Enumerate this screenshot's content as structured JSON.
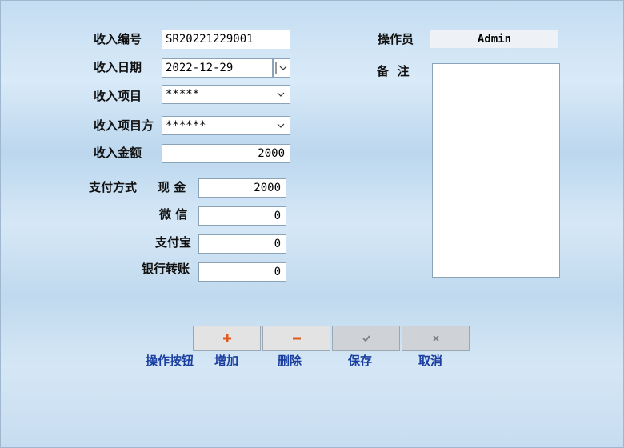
{
  "form": {
    "income_no_label": "收入编号",
    "income_no": "SR20221229001",
    "income_date_label": "收入日期",
    "income_date": "2022-12-29",
    "income_item_label": "收入项目",
    "income_item": "*****",
    "income_party_label": "收入项目方",
    "income_party": "******",
    "income_amount_label": "收入金额",
    "income_amount": "2000",
    "payment_method_label": "支付方式",
    "cash_label": "现 金",
    "cash": "2000",
    "wechat_label": "微 信",
    "wechat": "0",
    "alipay_label": "支付宝",
    "alipay": "0",
    "bank_label": "银行转账",
    "bank": "0",
    "operator_label": "操作员",
    "operator": "Admin",
    "remarks_label": "备  注",
    "remarks": ""
  },
  "toolbar": {
    "title": "操作按钮",
    "add_label": "增加",
    "delete_label": "删除",
    "save_label": "保存",
    "cancel_label": "取消",
    "add_icon": "plus-icon",
    "delete_icon": "minus-icon",
    "save_icon": "check-icon",
    "cancel_icon": "x-icon",
    "add_color": "#e05a1e",
    "delete_color": "#e05a1e",
    "label_color": "#1a3fa0"
  }
}
